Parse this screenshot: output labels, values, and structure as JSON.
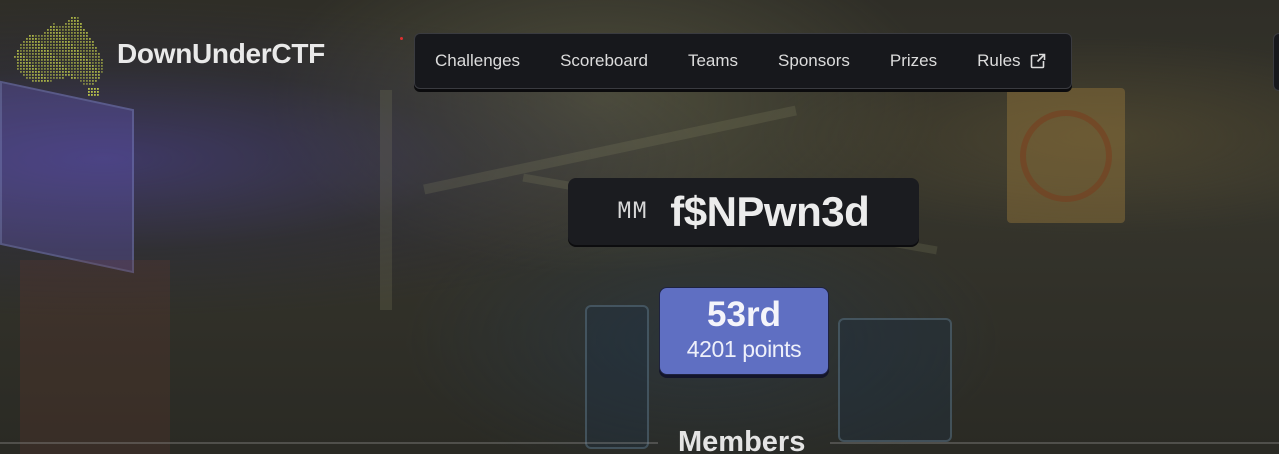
{
  "brand": {
    "logo_icon": "australia-map-logo-icon",
    "name": "DownUnderCTF"
  },
  "nav": {
    "items": [
      {
        "label": "Challenges"
      },
      {
        "label": "Scoreboard"
      },
      {
        "label": "Teams"
      },
      {
        "label": "Sponsors"
      },
      {
        "label": "Prizes"
      },
      {
        "label": "Rules",
        "icon": "external-link-icon"
      }
    ]
  },
  "team": {
    "tag": "MM",
    "name": "f$NPwn3d",
    "rank": "53rd",
    "points": "4201 points"
  },
  "members": {
    "title": "Members"
  },
  "colors": {
    "nav_bg": "#17181c",
    "rank_bg": "#5f6fc2",
    "logo": "#b8c24a"
  }
}
